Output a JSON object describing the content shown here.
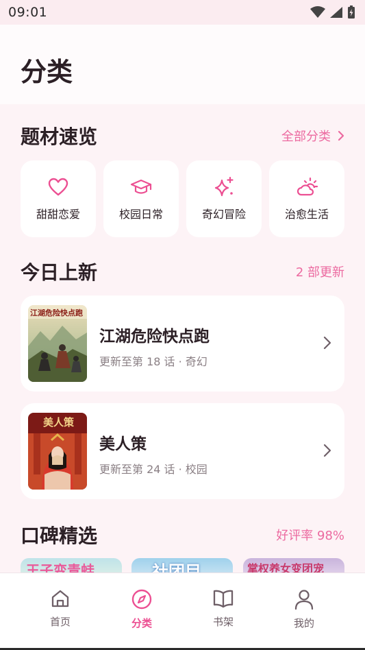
{
  "status_bar": {
    "time": "09:01"
  },
  "header": {
    "title": "分类"
  },
  "genres": {
    "title": "题材速览",
    "link": "全部分类",
    "items": [
      {
        "label": "甜甜恋爱",
        "icon": "heart-icon"
      },
      {
        "label": "校园日常",
        "icon": "graduation-cap-icon"
      },
      {
        "label": "奇幻冒险",
        "icon": "sparkles-icon"
      },
      {
        "label": "治愈生活",
        "icon": "sun-cloud-icon"
      }
    ]
  },
  "today": {
    "title": "今日上新",
    "count": "2 部更新",
    "items": [
      {
        "title": "江湖危险快点跑",
        "subtitle": "更新至第 18 话 · 奇幻",
        "cover_text": "江湖危险快点跑"
      },
      {
        "title": "美人策",
        "subtitle": "更新至第 24 话 · 校园",
        "cover_text": "美人策"
      }
    ]
  },
  "rating": {
    "title": "口碑精选",
    "percent": "好评率 98%",
    "covers": [
      "王子变青蛙",
      "社团目",
      "掌权养女变团宠"
    ]
  },
  "nav": {
    "items": [
      {
        "label": "首页",
        "icon": "home-icon",
        "active": false
      },
      {
        "label": "分类",
        "icon": "compass-icon",
        "active": true
      },
      {
        "label": "书架",
        "icon": "book-icon",
        "active": false
      },
      {
        "label": "我的",
        "icon": "user-icon",
        "active": false
      }
    ]
  },
  "colors": {
    "accent": "#ec4f92",
    "background": "#fdf3f6"
  }
}
